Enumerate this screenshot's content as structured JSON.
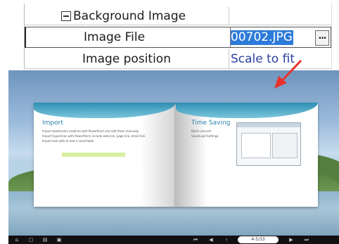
{
  "property_grid": {
    "category": {
      "label": "Background Image",
      "expanded": true
    },
    "rows": [
      {
        "label": "Image File",
        "value": "00702.JPG",
        "selected": true,
        "button_label": "···"
      },
      {
        "label": "Image position",
        "value": "Scale to fit"
      }
    ]
  },
  "preview": {
    "left_page": {
      "heading": "Import",
      "bullets": [
        "Import bookmarks (outline) with PowerPoint and edit them manually.",
        "Import hyperlinks with PowerPoint, include web link, page link, email link.",
        "Import text with to text a searchable."
      ]
    },
    "right_page": {
      "heading": "Time Saving",
      "bullets": [
        "Batch convert.",
        "Save/Load Settings."
      ]
    },
    "toolbar": {
      "page_counter": "4-5/33"
    }
  },
  "colors": {
    "selection": "#2d7bd9",
    "value_text": "#2b3fa0",
    "arrow": "#e8322b"
  }
}
